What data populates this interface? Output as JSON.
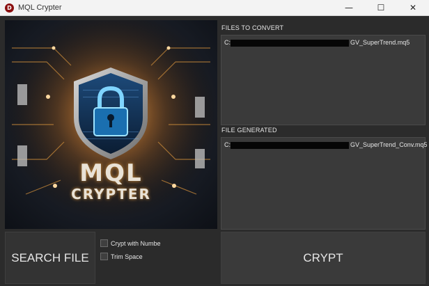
{
  "window": {
    "title": "MQL Crypter",
    "icon_letter": "D",
    "minimize_glyph": "—",
    "maximize_glyph": "☐",
    "close_glyph": "✕"
  },
  "logo": {
    "title": "MQL",
    "subtitle": "CRYPTER"
  },
  "files_to_convert": {
    "label": "FILES TO CONVERT",
    "value_prefix": "C:",
    "value_suffix": "GV_SuperTrend.mq5"
  },
  "file_generated": {
    "label": "FILE GENERATED",
    "value_prefix": "C:",
    "value_suffix": "GV_SuperTrend_Conv.mq5"
  },
  "buttons": {
    "search_file": "SEARCH FILE",
    "crypt": "CRYPT"
  },
  "options": {
    "crypt_with_number": {
      "label": "Crypt with Numbe",
      "checked": false
    },
    "trim_space": {
      "label": "Trim Space",
      "checked": false
    }
  },
  "colors": {
    "background": "#2b2b2b",
    "panel": "#3a3a3a",
    "accent_glow": "#f0a040"
  }
}
